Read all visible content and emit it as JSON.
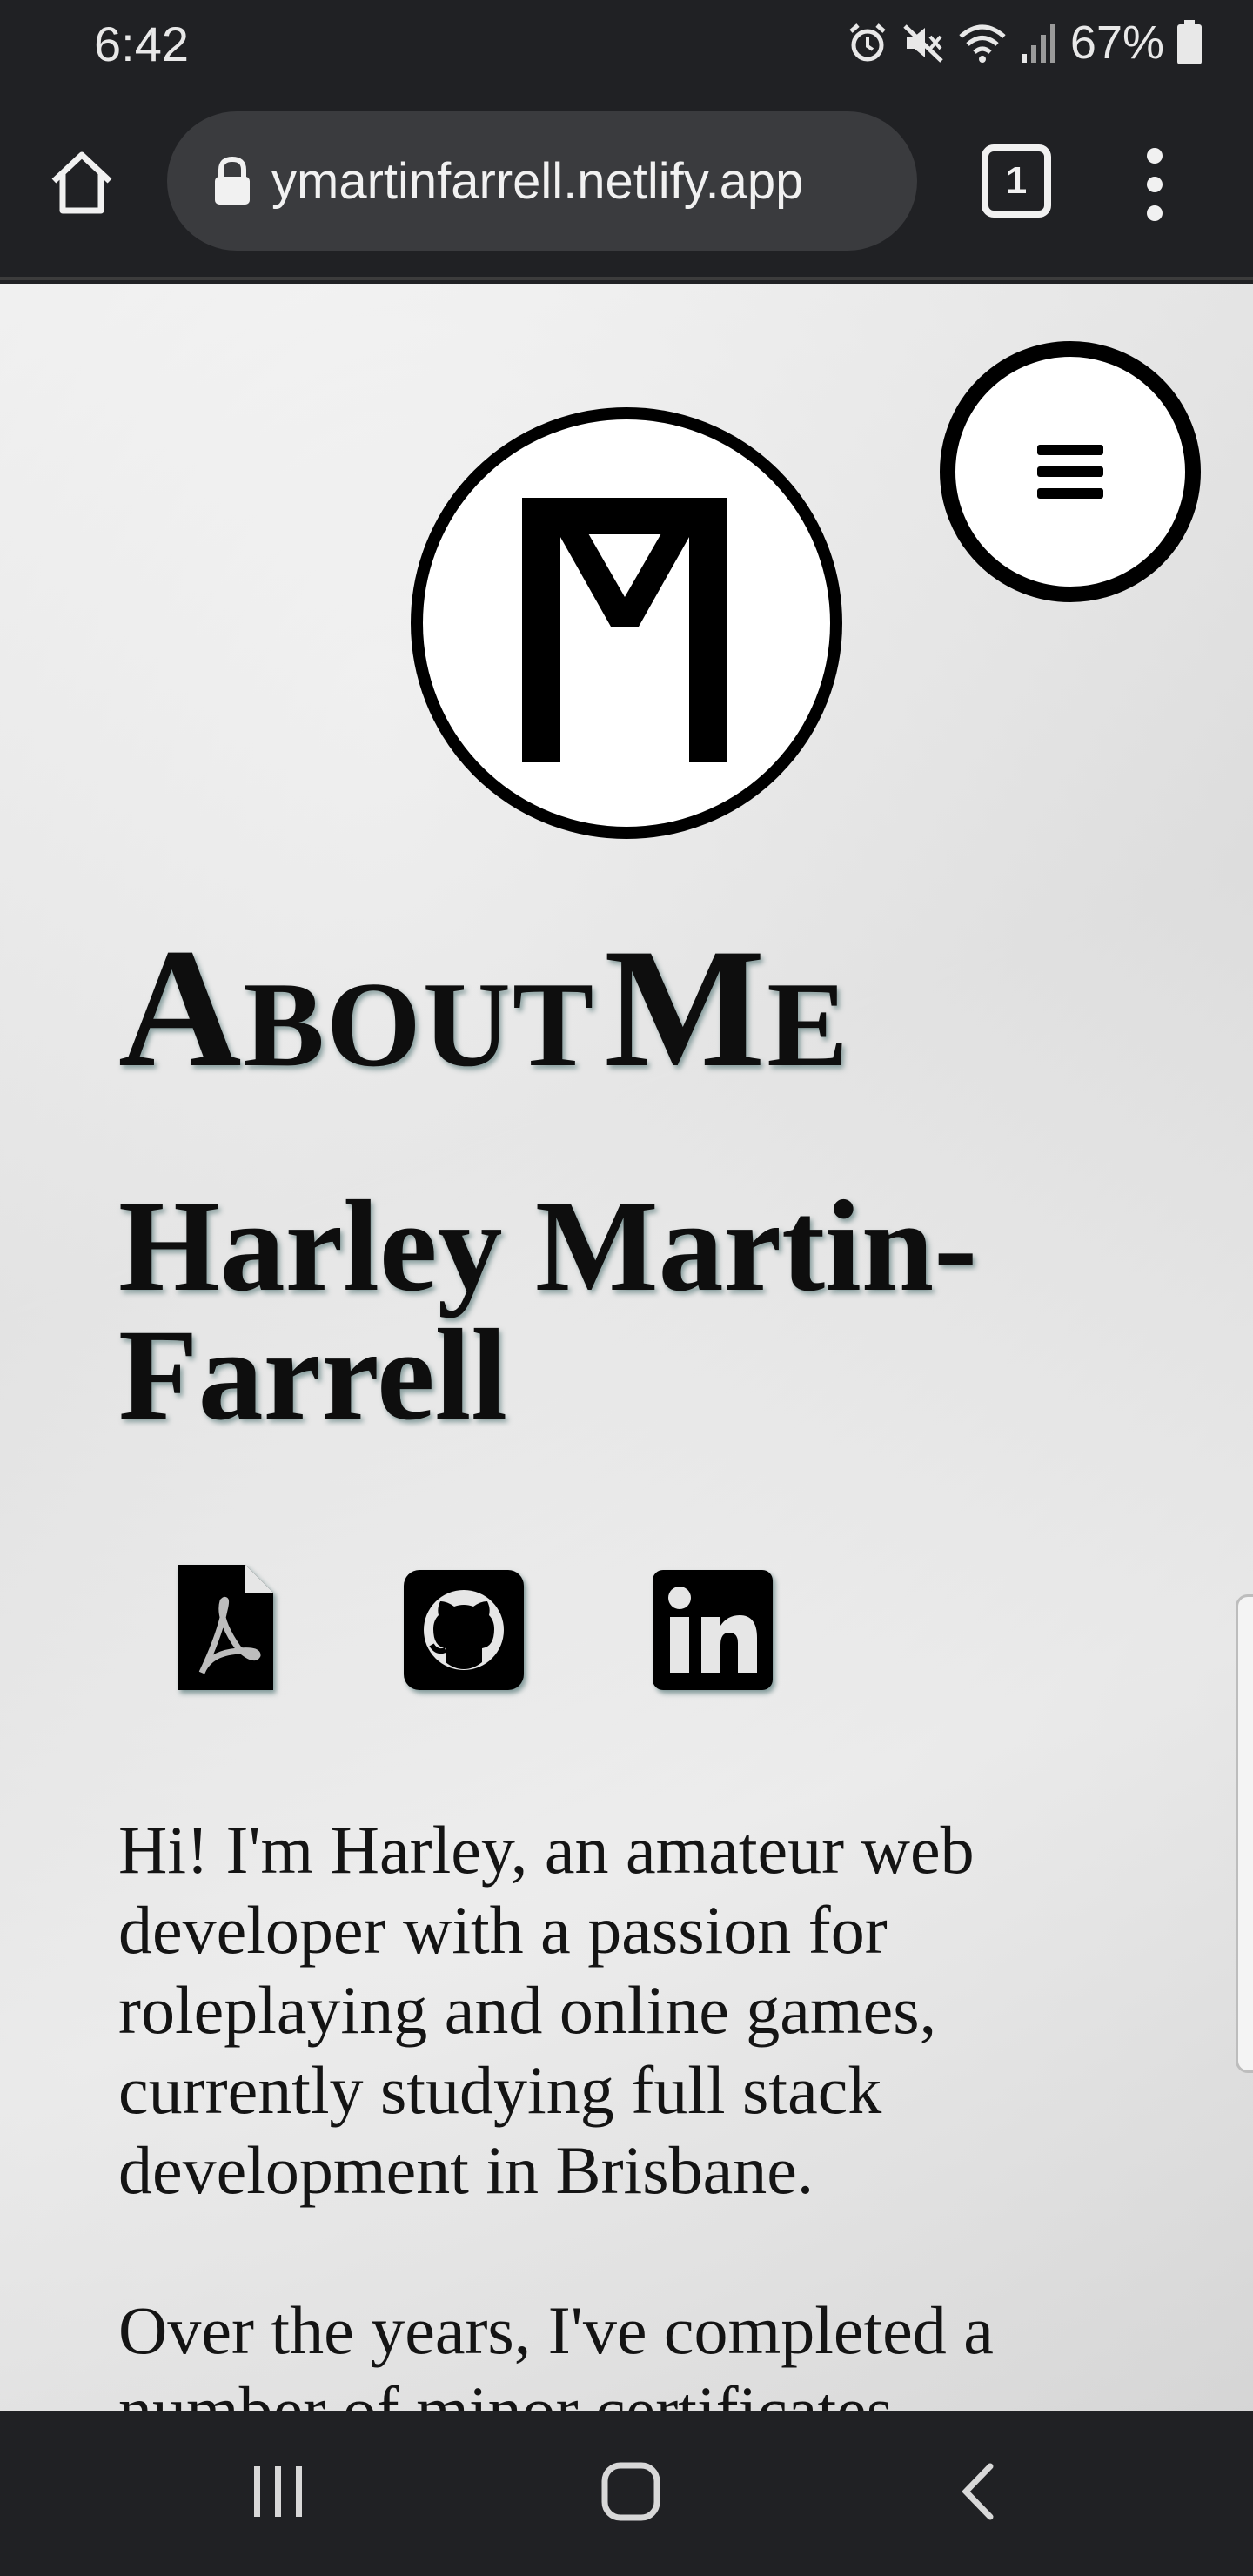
{
  "status_bar": {
    "time": "6:42",
    "battery": "67%",
    "icons": [
      "alarm-icon",
      "mute-icon",
      "wifi-icon",
      "signal-icon",
      "battery-icon"
    ]
  },
  "browser": {
    "url": "ymartinfarrell.netlify.app",
    "tab_count": "1",
    "icons": [
      "home-icon",
      "lock-icon",
      "more-vert-icon"
    ]
  },
  "page": {
    "logo_text": "FM",
    "heading": {
      "first_big": "A",
      "first_small": "BOUT",
      "second_big": "M",
      "second_small": "E"
    },
    "name": "Harley Martin-Farrell",
    "social_links": [
      {
        "name": "pdf-resume-icon"
      },
      {
        "name": "github-icon"
      },
      {
        "name": "linkedin-icon"
      }
    ],
    "bio_paragraph_1": "Hi! I'm Harley, an amateur web developer with a passion for roleplaying and online games, currently studying full stack development in Brisbane.",
    "bio_paragraph_2": "Over the years, I've completed a number of minor certificates"
  },
  "nav_bar": {
    "icons": [
      "recents-icon",
      "home-icon",
      "back-icon"
    ]
  }
}
